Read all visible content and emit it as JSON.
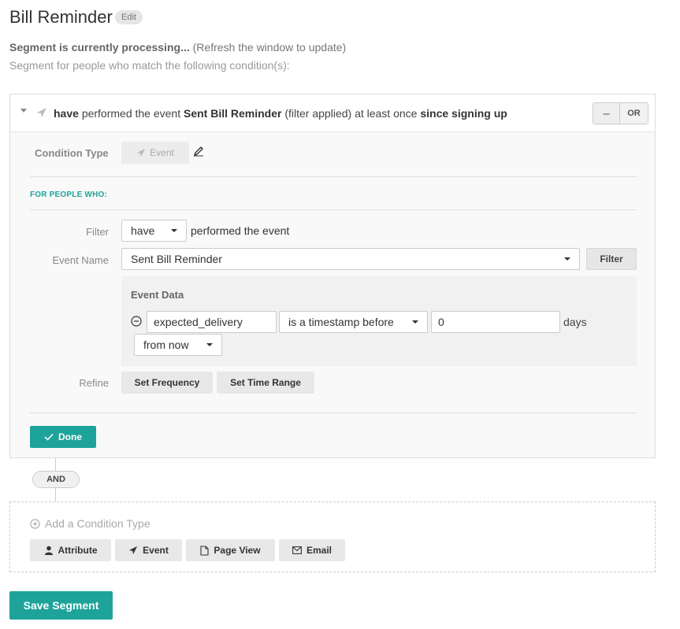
{
  "page": {
    "title": "Bill Reminder",
    "edit_label": "Edit",
    "processing_bold": "Segment is currently processing...",
    "processing_note": "(Refresh the window to update)",
    "subtitle": "Segment for people who match the following condition(s):"
  },
  "condition": {
    "header": {
      "have": "have",
      "performed": "performed the event",
      "event_name": "Sent Bill Reminder",
      "filter_note": "(filter applied) at least once",
      "timeframe": "since signing up"
    },
    "minus_label": "–",
    "or_label": "OR",
    "condition_type_label": "Condition Type",
    "condition_type_value": "Event",
    "for_people_label": "FOR PEOPLE WHO:",
    "filter_label": "Filter",
    "filter_value": "have",
    "filter_suffix": "performed the event",
    "event_name_label": "Event Name",
    "event_name_value": "Sent Bill Reminder",
    "filter_button": "Filter",
    "event_data": {
      "title": "Event Data",
      "property": "expected_delivery",
      "operator": "is a timestamp before",
      "value": "0",
      "unit": "days",
      "relative": "from now"
    },
    "refine_label": "Refine",
    "set_frequency": "Set Frequency",
    "set_time_range": "Set Time Range",
    "done_label": "Done"
  },
  "connector": {
    "and_label": "AND"
  },
  "add_condition": {
    "title": "Add a Condition Type",
    "buttons": {
      "attribute": "Attribute",
      "event": "Event",
      "page_view": "Page View",
      "email": "Email"
    }
  },
  "save_label": "Save Segment",
  "colors": {
    "accent": "#1ea39a",
    "muted": "#999999"
  }
}
